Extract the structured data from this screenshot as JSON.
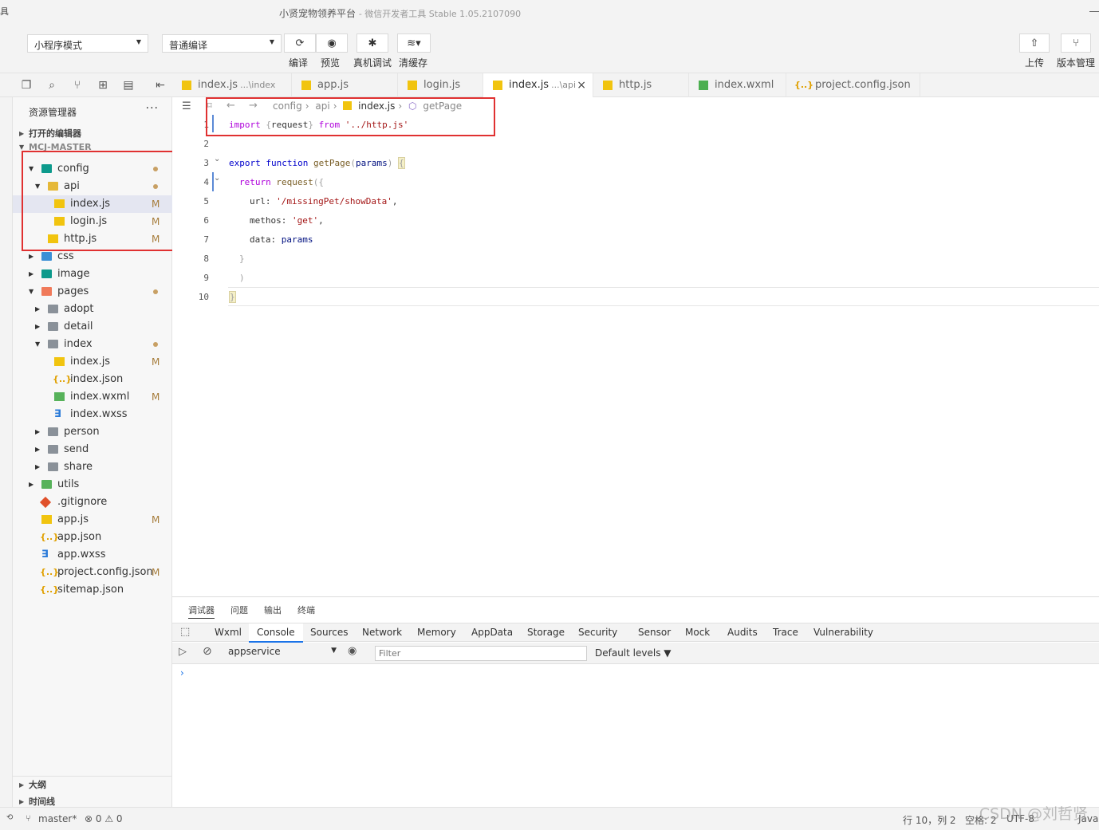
{
  "window": {
    "title": "小贤宠物领养平台",
    "subtitle": "- 微信开发者工具 Stable 1.05.2107090",
    "menu_glyph": "具"
  },
  "toolbar": {
    "mode_select": "小程序模式",
    "compile_select": "普通编译",
    "compile_label": "编译",
    "preview_label": "预览",
    "debug_label": "真机调试",
    "clear_cache_label": "清缓存",
    "upload_label": "上传",
    "version_label": "版本管理"
  },
  "tabs": [
    {
      "name": "index.js",
      "hint": "...\\index",
      "icon": "js"
    },
    {
      "name": "app.js",
      "hint": "",
      "icon": "js"
    },
    {
      "name": "login.js",
      "hint": "",
      "icon": "js"
    },
    {
      "name": "index.js",
      "hint": "...\\api",
      "icon": "js",
      "active": true
    },
    {
      "name": "http.js",
      "hint": "",
      "icon": "js"
    },
    {
      "name": "index.wxml",
      "hint": "",
      "icon": "wxml"
    },
    {
      "name": "project.config.json",
      "hint": "",
      "icon": "json"
    }
  ],
  "sidebar": {
    "title": "资源管理器",
    "more": "···",
    "open_editors": "打开的编辑器",
    "project": "MCJ-MASTER",
    "outline": "大纲",
    "timeline": "时间线",
    "tree": [
      {
        "label": "config",
        "mark": "dot"
      },
      {
        "label": "api",
        "mark": "dot"
      },
      {
        "label": "index.js",
        "mark": "M"
      },
      {
        "label": "login.js",
        "mark": "M"
      },
      {
        "label": "http.js",
        "mark": "M"
      },
      {
        "label": "css",
        "mark": ""
      },
      {
        "label": "image",
        "mark": ""
      },
      {
        "label": "pages",
        "mark": "dot"
      },
      {
        "label": "adopt",
        "mark": ""
      },
      {
        "label": "detail",
        "mark": ""
      },
      {
        "label": "index",
        "mark": "dot"
      },
      {
        "label": "index.js",
        "mark": "M"
      },
      {
        "label": "index.json",
        "mark": ""
      },
      {
        "label": "index.wxml",
        "mark": "M"
      },
      {
        "label": "index.wxss",
        "mark": ""
      },
      {
        "label": "person",
        "mark": ""
      },
      {
        "label": "send",
        "mark": ""
      },
      {
        "label": "share",
        "mark": ""
      },
      {
        "label": "utils",
        "mark": ""
      },
      {
        "label": ".gitignore",
        "mark": ""
      },
      {
        "label": "app.js",
        "mark": "M"
      },
      {
        "label": "app.json",
        "mark": ""
      },
      {
        "label": "app.wxss",
        "mark": ""
      },
      {
        "label": "project.config.json",
        "mark": "M"
      },
      {
        "label": "sitemap.json",
        "mark": ""
      }
    ]
  },
  "editor": {
    "breadcrumb": [
      "config",
      "api",
      "index.js",
      "getPage"
    ],
    "line_numbers": [
      "1",
      "2",
      "3",
      "4",
      "5",
      "6",
      "7",
      "8",
      "9",
      "10"
    ]
  },
  "panel": {
    "tabs": [
      "调试器",
      "问题",
      "输出",
      "终端"
    ],
    "devtools_tabs": [
      "Wxml",
      "Console",
      "Sources",
      "Network",
      "Memory",
      "AppData",
      "Storage",
      "Security",
      "Sensor",
      "Mock",
      "Audits",
      "Trace",
      "Vulnerability"
    ],
    "context": "appservice",
    "filter_placeholder": "Filter",
    "levels": "Default levels ▼",
    "prompt": "›"
  },
  "statusbar": {
    "branch": "master*",
    "problems": "⊗ 0 ⚠ 0",
    "position": "行 10，列 2",
    "spaces": "空格: 2",
    "encoding": "UTF-8",
    "lang": "JavaS"
  },
  "watermark": "CSDN @刘哲贤"
}
